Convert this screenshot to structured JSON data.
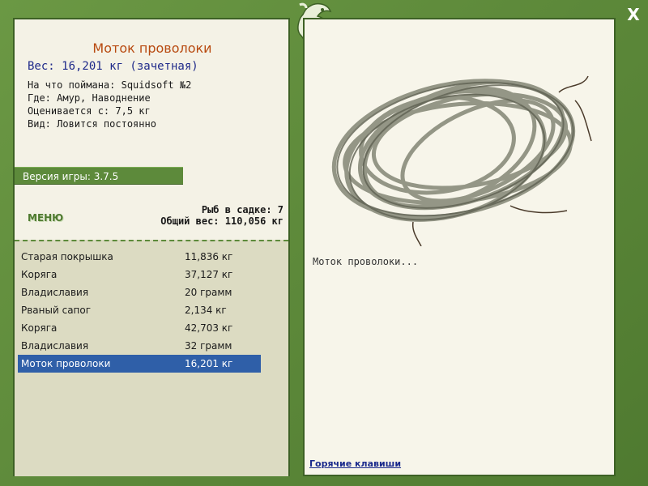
{
  "close_label": "X",
  "fish": {
    "title": "Моток проволоки",
    "weight_line": "Вес: 16,201 кг (зачетная)",
    "caught_on": "На что поймана: Squidsoft №2",
    "location": "Где: Амур, Наводнение",
    "rated_from": "Оценивается с: 7,5 кг",
    "kind": "Вид: Ловится постоянно",
    "description": "Моток проволоки..."
  },
  "version": "Версия игры: 3.7.5",
  "menu_label": "МЕНЮ",
  "cage": {
    "count_line": "Рыб в садке: 7",
    "total_line": "Общий вес: 110,056 кг"
  },
  "catch_list": [
    {
      "name": "Старая покрышка",
      "weight": "11,836 кг"
    },
    {
      "name": "Коряга",
      "weight": "37,127 кг"
    },
    {
      "name": "Владиславия",
      "weight": "20 грамм"
    },
    {
      "name": "Рваный сапог",
      "weight": "2,134 кг"
    },
    {
      "name": "Коряга",
      "weight": "42,703 кг"
    },
    {
      "name": "Владиславия",
      "weight": "32 грамм"
    },
    {
      "name": "Моток проволоки",
      "weight": "16,201 кг"
    }
  ],
  "selected_index": 6,
  "hotkeys_label": "Горячие клавиши",
  "colors": {
    "frame": "#5e8a3a",
    "title": "#b84a10",
    "weight": "#1f2a8a",
    "selection": "#2f5fa8"
  }
}
